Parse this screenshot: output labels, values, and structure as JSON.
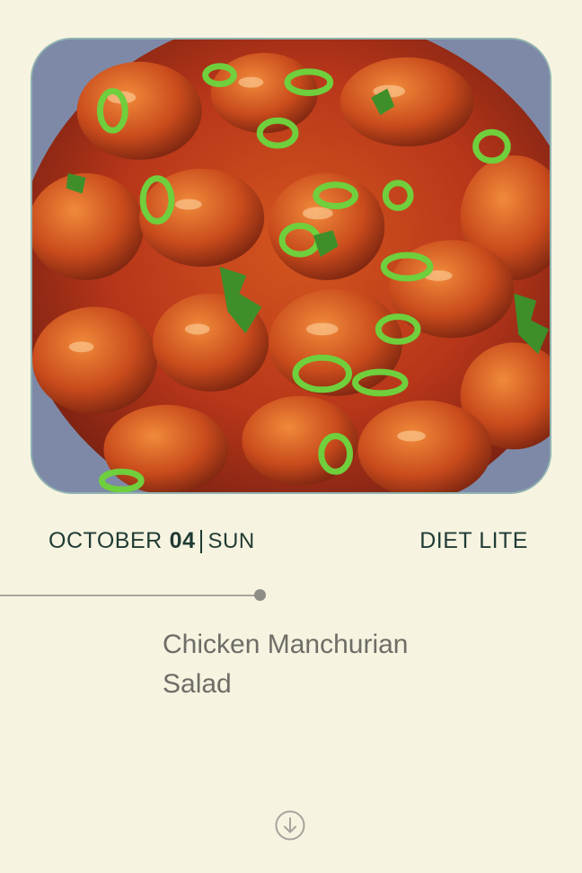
{
  "hero_image": {
    "alt": "Chicken Manchurian dish"
  },
  "date": {
    "month": "OCTOBER",
    "day": "04",
    "weekday": "SUN"
  },
  "diet_plan": "DIET LITE",
  "meal": {
    "name_line1": "Chicken Manchurian",
    "name_line2": "Salad"
  },
  "icons": {
    "scroll": "arrow-down-circle-icon"
  },
  "colors": {
    "background": "#f6f3e1",
    "text_dark": "#1f3b33",
    "text_muted": "#6e6d66",
    "timeline": "#a8a79b"
  }
}
